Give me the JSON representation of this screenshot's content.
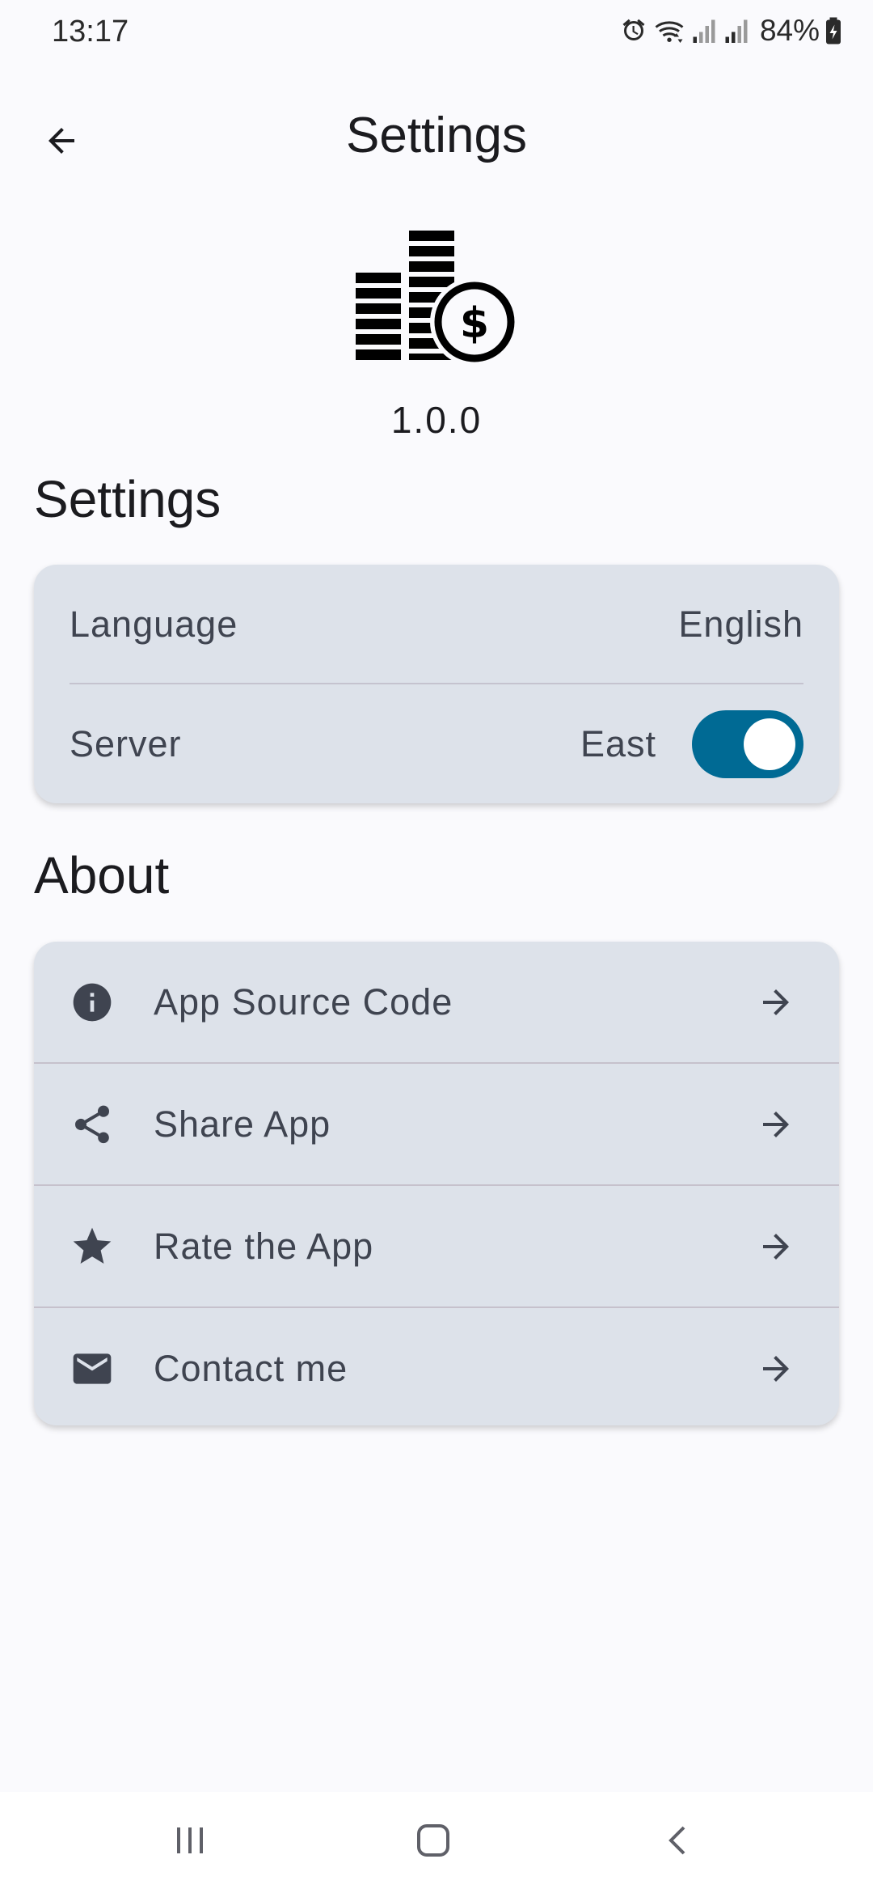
{
  "status_bar": {
    "time": "13:17",
    "battery": "84%",
    "icons": [
      "alarm-icon",
      "wifi-icon",
      "signal-icon",
      "signal-icon",
      "battery-charging-icon"
    ]
  },
  "app_bar": {
    "title": "Settings",
    "back_icon": "arrow-back-icon"
  },
  "header": {
    "logo_icon": "coins-dollar-icon",
    "version": "1.0.0"
  },
  "settings_section": {
    "title": "Settings",
    "language_label": "Language",
    "language_value": "English",
    "server_label": "Server",
    "server_value": "East",
    "server_toggle_on": true
  },
  "about_section": {
    "title": "About",
    "items": [
      {
        "label": "App Source Code",
        "icon": "info-icon"
      },
      {
        "label": "Share App",
        "icon": "share-icon"
      },
      {
        "label": "Rate the App",
        "icon": "star-icon"
      },
      {
        "label": "Contact me",
        "icon": "mail-icon"
      }
    ]
  },
  "colors": {
    "accent": "#006a94",
    "card_background": "#dde2ea",
    "page_background": "#fafafd",
    "text_secondary": "#3f4450"
  },
  "nav_bar": {
    "buttons": [
      "recents-icon",
      "home-icon",
      "back-icon"
    ]
  }
}
